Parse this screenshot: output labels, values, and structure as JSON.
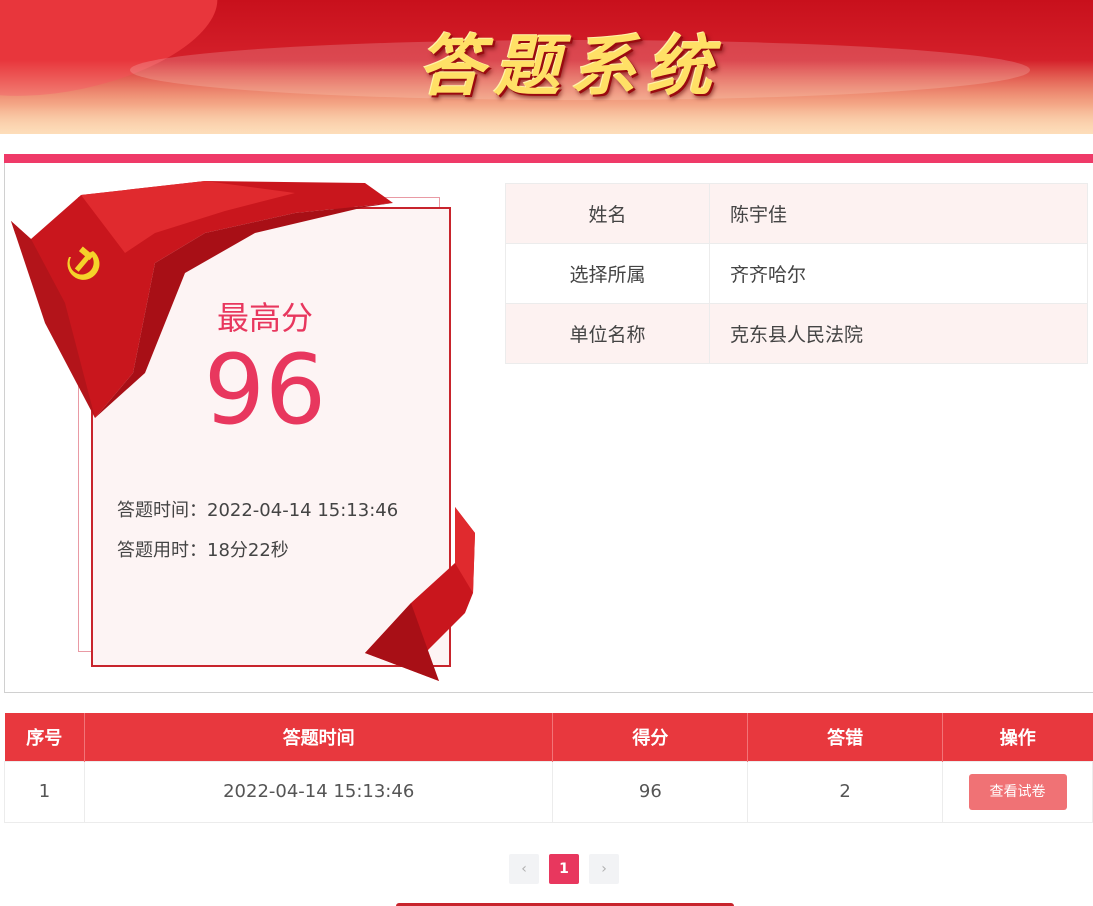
{
  "header": {
    "title": "答题系统"
  },
  "score_card": {
    "label": "最高分",
    "value": "96",
    "answer_time": "答题时间：2022-04-14 15:13:46",
    "duration": "答题用时：18分22秒"
  },
  "profile": {
    "rows": [
      {
        "key": "姓名",
        "value": "陈宇佳"
      },
      {
        "key": "选择所属",
        "value": "齐齐哈尔"
      },
      {
        "key": "单位名称",
        "value": "克东县人民法院"
      }
    ]
  },
  "records": {
    "columns": [
      "序号",
      "答题时间",
      "得分",
      "答错",
      "操作"
    ],
    "rows": [
      {
        "index": "1",
        "time": "2022-04-14 15:13:46",
        "score": "96",
        "wrong": "2",
        "action": "查看试卷"
      }
    ]
  },
  "pagination": {
    "prev": "‹",
    "current": "1",
    "next": "›"
  },
  "colors": {
    "accent": "#e8375e",
    "header_red": "#e8383e",
    "button": "#f07275"
  }
}
